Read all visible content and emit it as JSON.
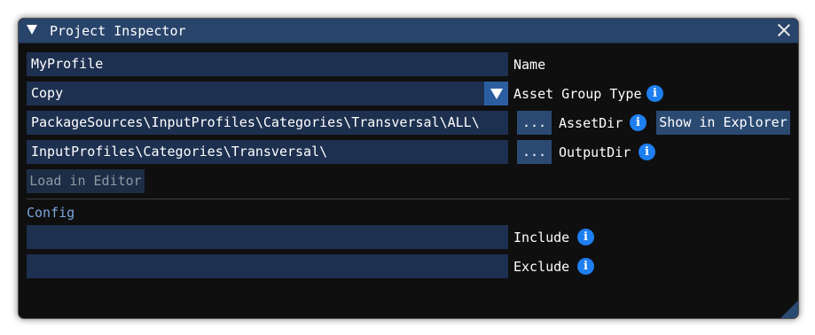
{
  "window": {
    "title": "Project Inspector"
  },
  "name_row": {
    "value": "MyProfile",
    "label": "Name"
  },
  "asset_group_row": {
    "value": "Copy",
    "label": "Asset Group Type",
    "info": "i"
  },
  "asset_dir_row": {
    "value": "PackageSources\\InputProfiles\\Categories\\Transversal\\ALL\\",
    "browse": "...",
    "label": "AssetDir",
    "info": "i",
    "show_in_explorer": "Show in Explorer"
  },
  "output_dir_row": {
    "value": "InputProfiles\\Categories\\Transversal\\",
    "browse": "...",
    "label": "OutputDir",
    "info": "i"
  },
  "load_in_editor": "Load in Editor",
  "config": {
    "heading": "Config",
    "include": {
      "value": "",
      "label": "Include",
      "info": "i"
    },
    "exclude": {
      "value": "",
      "label": "Exclude",
      "info": "i"
    }
  },
  "colors": {
    "titlebar": "#29446b",
    "field": "#1e3050",
    "button": "#2b4a72",
    "info": "#1e7ff0",
    "section": "#7aa6dd"
  }
}
